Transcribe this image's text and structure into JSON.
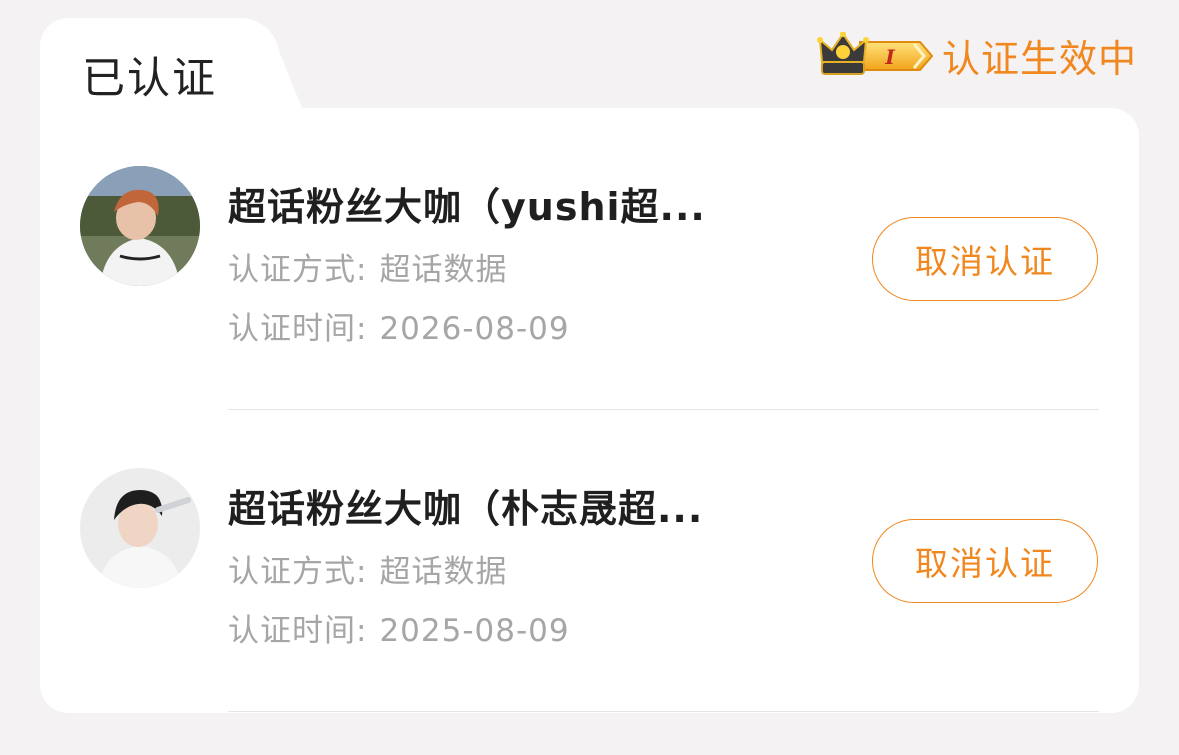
{
  "header": {
    "tab_title": "已认证",
    "status_badge_text": "I",
    "status_text": "认证生效中"
  },
  "colors": {
    "accent": "#f0871f",
    "background": "#f4f2f3",
    "card": "#ffffff"
  },
  "items": [
    {
      "title": "超话粉丝大咖（yushi超...",
      "method_label": "认证方式:",
      "method_value": "超话数据",
      "time_label": "认证时间:",
      "time_value": "2026-08-09",
      "cancel_label": "取消认证"
    },
    {
      "title": "超话粉丝大咖（朴志晟超...",
      "method_label": "认证方式:",
      "method_value": "超话数据",
      "time_label": "认证时间:",
      "time_value": "2025-08-09",
      "cancel_label": "取消认证"
    }
  ]
}
